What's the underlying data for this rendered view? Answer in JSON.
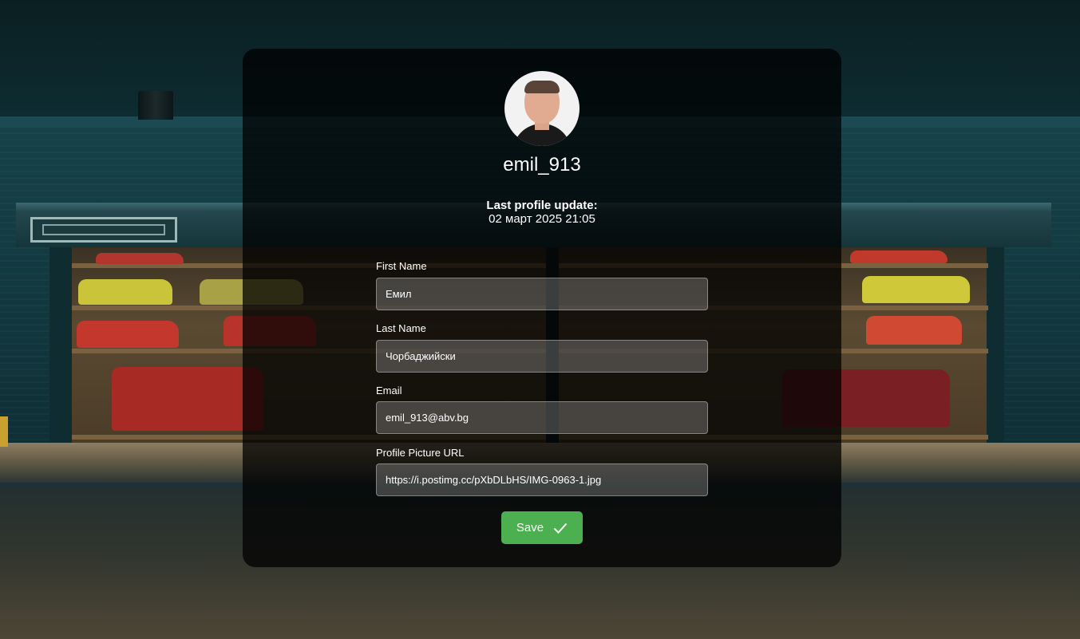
{
  "profile": {
    "username": "emil_913",
    "last_update_label": "Last profile update:",
    "last_update_value": "02 март 2025 21:05",
    "avatar_icon": "user-photo"
  },
  "form": {
    "first_name": {
      "label": "First Name",
      "value": "Емил"
    },
    "last_name": {
      "label": "Last Name",
      "value": "Чорбаджийски"
    },
    "email": {
      "label": "Email",
      "value": "emil_913@abv.bg"
    },
    "picture_url": {
      "label": "Profile Picture URL",
      "value": "https://i.postimg.cc/pXbDLbHS/IMG-0963-1.jpg"
    },
    "save_label": "Save",
    "save_icon": "check-icon"
  },
  "colors": {
    "save_button": "#4caf50",
    "card_background": "rgba(0,0,0,0.74)"
  }
}
